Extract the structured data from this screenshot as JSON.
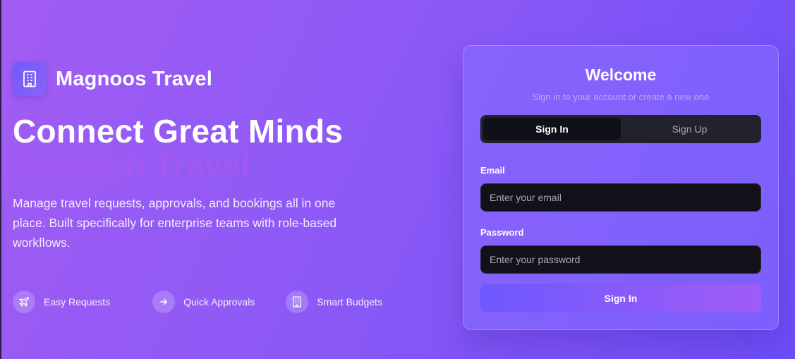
{
  "brand": {
    "name": "Magnoos Travel",
    "logo_icon": "building-icon"
  },
  "hero": {
    "title": "Connect Great Minds",
    "accent": "Through Travel",
    "description": "Manage travel requests, approvals, and bookings all in one place. Built specifically for enterprise teams with role-based workflows."
  },
  "features": [
    {
      "label": "Easy Requests",
      "icon": "plane-icon"
    },
    {
      "label": "Quick Approvals",
      "icon": "arrow-right-icon"
    },
    {
      "label": "Smart Budgets",
      "icon": "building-icon"
    }
  ],
  "auth": {
    "title": "Welcome",
    "subtitle": "Sign in to your account or create a new one",
    "tabs": [
      {
        "label": "Sign In",
        "active": true
      },
      {
        "label": "Sign Up",
        "active": false
      }
    ],
    "email": {
      "label": "Email",
      "placeholder": "Enter your email"
    },
    "password": {
      "label": "Password",
      "placeholder": "Enter your password"
    },
    "submit_label": "Sign In"
  },
  "colors": {
    "background_start": "#a25cf3",
    "background_end": "#6c4df9",
    "accent_text": "#a659ef",
    "input_bg": "#12111a",
    "button_start": "#6e58ff",
    "button_end": "#a05cf6"
  }
}
